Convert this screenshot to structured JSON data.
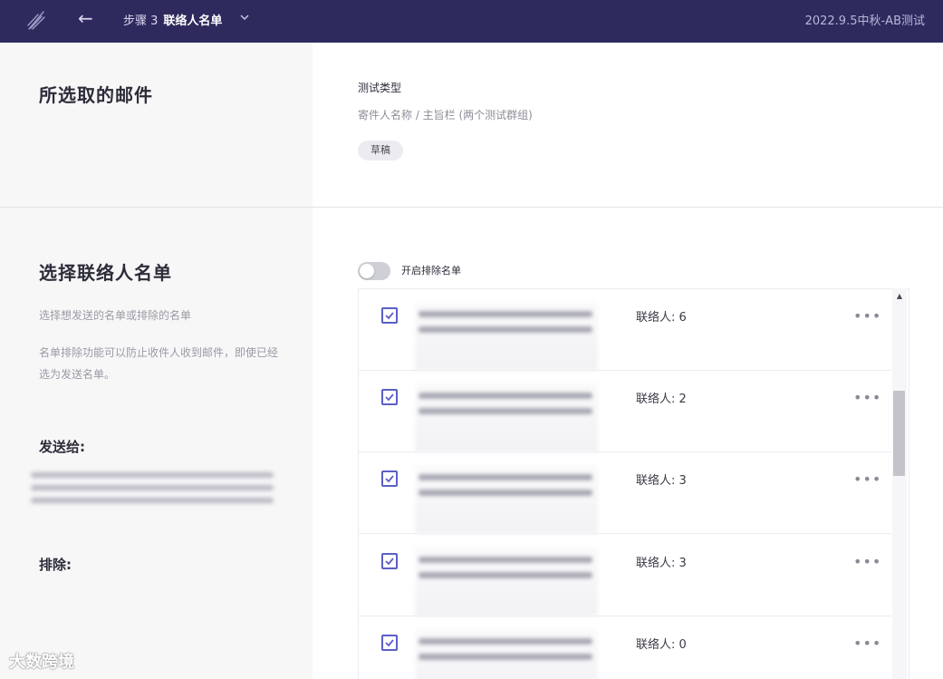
{
  "header": {
    "step_label": "步骤 3",
    "step_name": "联络人名单",
    "campaign_name": "2022.9.5中秋-AB测试",
    "logo_icon": "feather-logo-icon",
    "back_icon": "arrow-left-icon",
    "dropdown_icon": "chevron-down-icon"
  },
  "selected_email": {
    "title": "所选取的邮件",
    "test_type_label": "测试类型",
    "test_type_value": "寄件人名称 / 主旨栏 (两个测试群组)",
    "status_badge": "草稿"
  },
  "contact_lists": {
    "title": "选择联络人名单",
    "description_1": "选择想发送的名单或排除的名单",
    "description_2": "名单排除功能可以防止收件人收到邮件，即使已经选为发送名单。",
    "send_to_label": "发送给:",
    "exclude_label": "排除:",
    "toggle_label": "开启排除名单",
    "toggle_on": false,
    "rows": [
      {
        "checked": true,
        "contacts": "联络人: 6"
      },
      {
        "checked": true,
        "contacts": "联络人: 2"
      },
      {
        "checked": true,
        "contacts": "联络人: 3"
      },
      {
        "checked": true,
        "contacts": "联络人: 3"
      },
      {
        "checked": true,
        "contacts": "联络人: 0"
      }
    ],
    "more_label": "•••"
  },
  "watermark": "大数跨境",
  "colors": {
    "header_bg": "#2e2a5e",
    "accent": "#5b5fc7",
    "page_bg": "#f7f7f8"
  }
}
